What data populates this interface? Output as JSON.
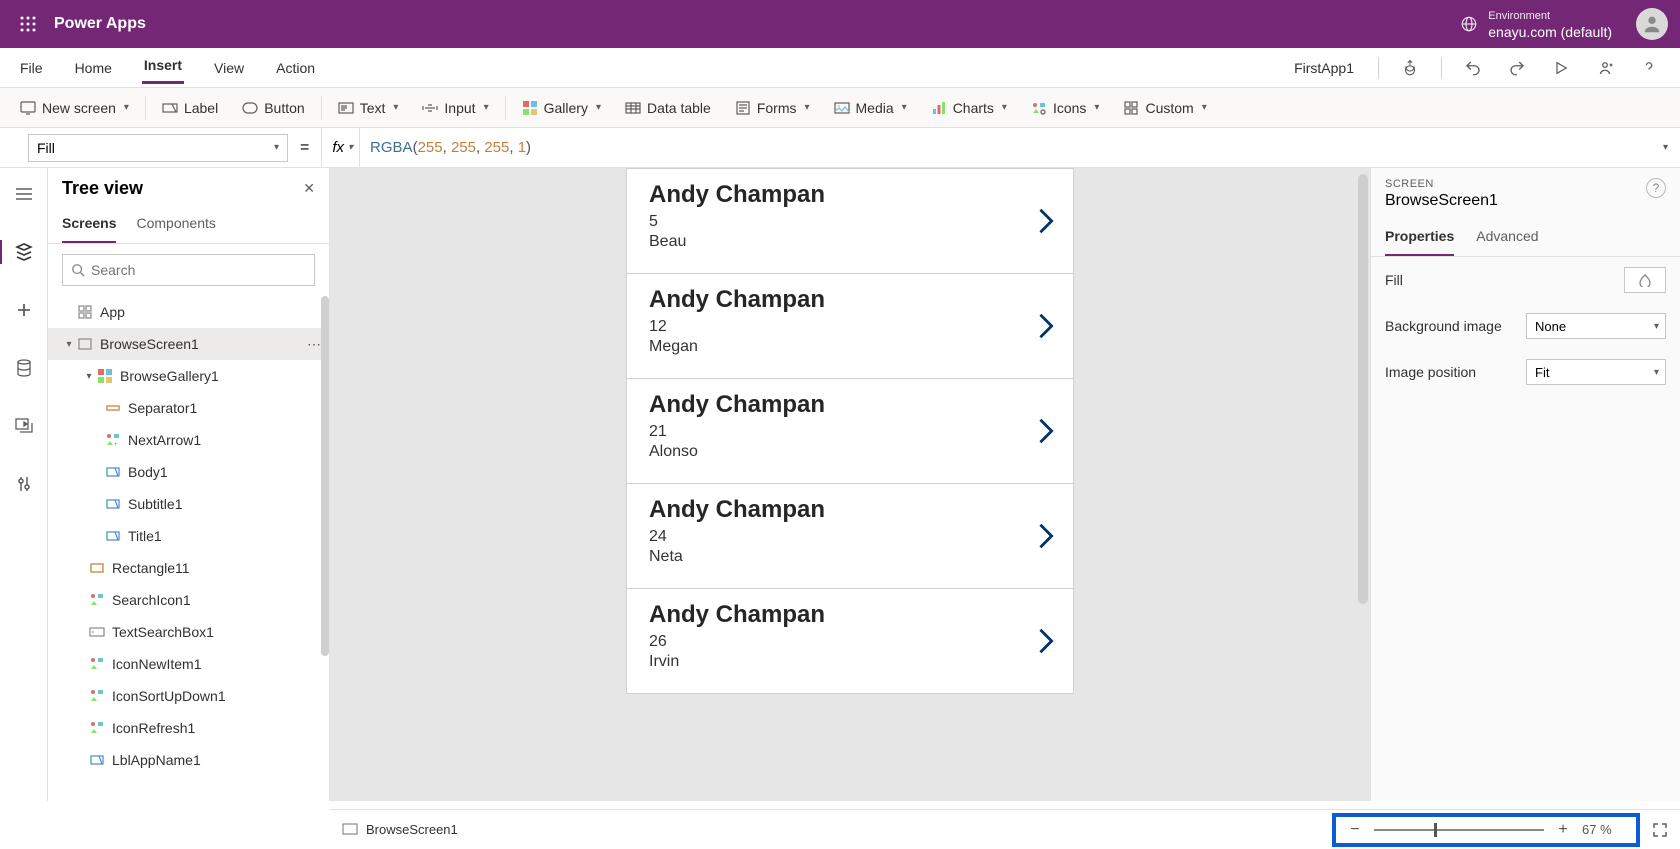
{
  "titlebar": {
    "app_title": "Power Apps",
    "env_label": "Environment",
    "env_name": "enayu.com (default)"
  },
  "menubar": {
    "items": [
      "File",
      "Home",
      "Insert",
      "View",
      "Action"
    ],
    "active": "Insert",
    "app_name": "FirstApp1"
  },
  "ribbon": {
    "new_screen": "New screen",
    "label": "Label",
    "button": "Button",
    "text": "Text",
    "input": "Input",
    "gallery": "Gallery",
    "data_table": "Data table",
    "forms": "Forms",
    "media": "Media",
    "charts": "Charts",
    "icons": "Icons",
    "custom": "Custom"
  },
  "formula": {
    "property": "Fill",
    "fn": "RGBA",
    "args": [
      "255",
      "255",
      "255",
      "1"
    ]
  },
  "tree": {
    "title": "Tree view",
    "tabs": {
      "screens": "Screens",
      "components": "Components"
    },
    "search_placeholder": "Search",
    "nodes": {
      "app": "App",
      "browse_screen": "BrowseScreen1",
      "browse_gallery": "BrowseGallery1",
      "separator": "Separator1",
      "next_arrow": "NextArrow1",
      "body": "Body1",
      "subtitle": "Subtitle1",
      "title": "Title1",
      "rectangle": "Rectangle11",
      "search_icon": "SearchIcon1",
      "text_search_box": "TextSearchBox1",
      "icon_new_item": "IconNewItem1",
      "icon_sort": "IconSortUpDown1",
      "icon_refresh": "IconRefresh1",
      "lbl_app_name": "LblAppName1"
    }
  },
  "gallery_items": [
    {
      "title": "Andy Champan",
      "sub": "5",
      "body": "Beau"
    },
    {
      "title": "Andy Champan",
      "sub": "12",
      "body": "Megan"
    },
    {
      "title": "Andy Champan",
      "sub": "21",
      "body": "Alonso"
    },
    {
      "title": "Andy Champan",
      "sub": "24",
      "body": "Neta"
    },
    {
      "title": "Andy Champan",
      "sub": "26",
      "body": "Irvin"
    }
  ],
  "properties": {
    "section_label": "SCREEN",
    "object_name": "BrowseScreen1",
    "tabs": {
      "properties": "Properties",
      "advanced": "Advanced"
    },
    "fill_label": "Fill",
    "bg_image_label": "Background image",
    "bg_image_value": "None",
    "img_pos_label": "Image position",
    "img_pos_value": "Fit"
  },
  "statusbar": {
    "screen_name": "BrowseScreen1",
    "zoom": "67  %"
  }
}
